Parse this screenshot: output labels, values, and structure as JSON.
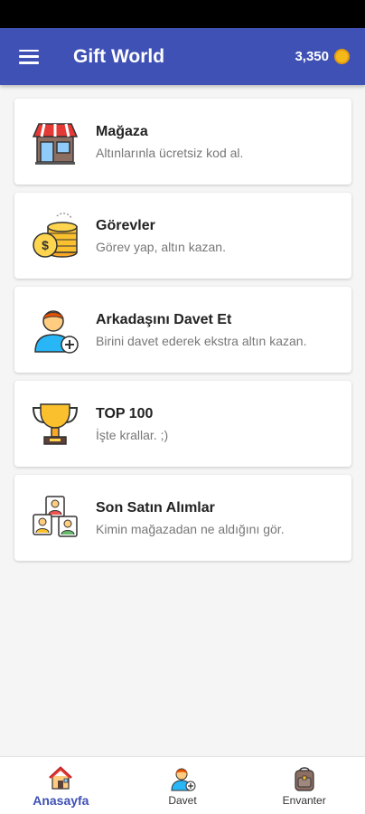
{
  "app_bar": {
    "title": "Gift World",
    "balance": "3,350",
    "menu_icon": "hamburger-menu-icon",
    "coin_icon": "gold-coin-icon"
  },
  "menu": [
    {
      "title": "Mağaza",
      "subtitle": "Altınlarınla ücretsiz kod al.",
      "icon": "store-icon"
    },
    {
      "title": "Görevler",
      "subtitle": "Görev yap, altın kazan.",
      "icon": "coin-stack-icon"
    },
    {
      "title": "Arkadaşını Davet Et",
      "subtitle": "Birini davet ederek ekstra altın kazan.",
      "icon": "add-user-icon"
    },
    {
      "title": "TOP 100",
      "subtitle": "İşte krallar. ;)",
      "icon": "trophy-icon"
    },
    {
      "title": "Son Satın Alımlar",
      "subtitle": "Kimin mağazadan ne aldığını gör.",
      "icon": "people-group-icon"
    }
  ],
  "bottom_nav": [
    {
      "label": "Anasayfa",
      "icon": "home-icon",
      "active": true
    },
    {
      "label": "Davet",
      "icon": "invite-user-icon",
      "active": false
    },
    {
      "label": "Envanter",
      "icon": "backpack-icon",
      "active": false
    }
  ],
  "colors": {
    "primary": "#3f51b5",
    "coin": "#f5b81b",
    "background": "#f5f5f5"
  }
}
